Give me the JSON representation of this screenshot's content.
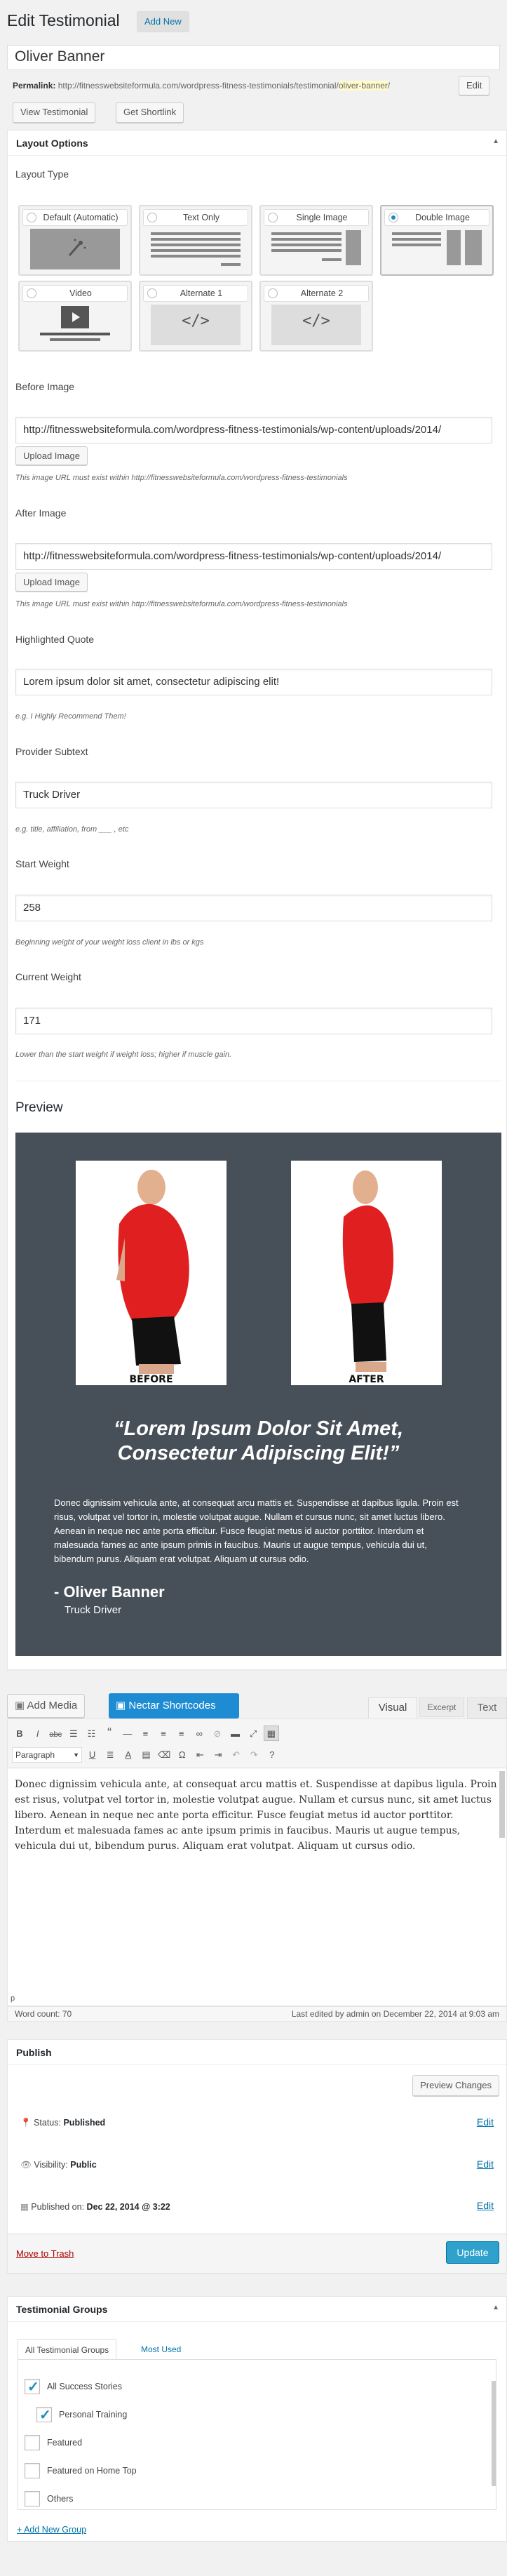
{
  "header": {
    "title": "Edit Testimonial",
    "add_new": "Add New"
  },
  "post": {
    "title": "Oliver Banner",
    "permalink_label": "Permalink:",
    "permalink_base": "http://fitnesswebsiteformula.com/wordpress-fitness-testimonials/testimonial/",
    "permalink_slug": "oliver-banner",
    "permalink_end": "/",
    "edit_button": "Edit",
    "view_button": "View Testimonial",
    "shortlink_button": "Get Shortlink"
  },
  "layout_panel": {
    "title": "Layout Options",
    "layout_type_label": "Layout Type",
    "options": [
      {
        "label": "Default (Automatic)",
        "selected": false,
        "icon": "magic-wand-icon"
      },
      {
        "label": "Text Only",
        "selected": false,
        "icon": "text-lines-icon"
      },
      {
        "label": "Single Image",
        "selected": false,
        "icon": "single-image-icon"
      },
      {
        "label": "Double Image",
        "selected": true,
        "icon": "double-image-icon"
      },
      {
        "label": "Video",
        "selected": false,
        "icon": "video-icon"
      },
      {
        "label": "Alternate 1",
        "selected": false,
        "icon": "code-icon"
      },
      {
        "label": "Alternate 2",
        "selected": false,
        "icon": "code-icon"
      }
    ],
    "before_image": {
      "label": "Before Image",
      "value": "http://fitnesswebsiteformula.com/wordpress-fitness-testimonials/wp-content/uploads/2014/",
      "upload": "Upload Image",
      "hint": "This image URL must exist within http://fitnesswebsiteformula.com/wordpress-fitness-testimonials"
    },
    "after_image": {
      "label": "After Image",
      "value": "http://fitnesswebsiteformula.com/wordpress-fitness-testimonials/wp-content/uploads/2014/",
      "upload": "Upload Image",
      "hint": "This image URL must exist within http://fitnesswebsiteformula.com/wordpress-fitness-testimonials"
    },
    "highlighted_quote": {
      "label": "Highlighted Quote",
      "value": "Lorem ipsum dolor sit amet, consectetur adipiscing elit!",
      "hint": "e.g. I Highly Recommend Them!"
    },
    "provider_subtext": {
      "label": "Provider Subtext",
      "value": "Truck Driver",
      "hint": "e.g. title, affiliation, from ___ , etc"
    },
    "start_weight": {
      "label": "Start Weight",
      "value": "258",
      "hint": "Beginning weight of your weight loss client in lbs or kgs"
    },
    "current_weight": {
      "label": "Current Weight",
      "value": "171",
      "hint": "Lower than the start weight if weight loss; higher if muscle gain."
    }
  },
  "preview": {
    "heading": "Preview",
    "before_label": "BEFORE",
    "after_label": "AFTER",
    "quote_line1": "“Lorem Ipsum Dolor Sit Amet,",
    "quote_line2": "Consectetur Adipiscing Elit!”",
    "body": "Donec dignissim vehicula ante, at consequat arcu mattis et. Suspendisse at dapibus ligula. Proin est risus, volutpat vel tortor in, molestie volutpat augue. Nullam et cursus nunc, sit amet luctus libero. Aenean in neque nec ante porta efficitur. Fusce feugiat metus id auctor porttitor. Interdum et malesuada fames ac ante ipsum primis in faucibus. Mauris ut augue tempus, vehicula dui ut, bibendum purus. Aliquam erat volutpat. Aliquam ut cursus odio.",
    "name": "- Oliver Banner",
    "subtext": "Truck Driver",
    "colors": {
      "background": "#474f58",
      "shirt": "#e02020"
    }
  },
  "editor": {
    "add_media": "Add Media",
    "nectar": "Nectar Shortcodes",
    "tab_visual": "Visual",
    "tab_excerpt": "Excerpt",
    "tab_text": "Text",
    "paragraph_select": "Paragraph",
    "content": "Donec dignissim vehicula ante, at consequat arcu mattis et. Suspendisse at dapibus ligula. Proin est risus, volutpat vel tortor in, molestie volutpat augue. Nullam et cursus nunc, sit amet luctus libero. Aenean in neque nec ante porta efficitur. Fusce feugiat metus id auctor porttitor. Interdum et malesuada fames ac ante ipsum primis in faucibus. Mauris ut augue tempus, vehicula dui ut, bibendum purus. Aliquam erat volutpat. Aliquam ut cursus odio.",
    "path": "p",
    "word_count": "Word count: 70",
    "last_edited": "Last edited by admin on December 22, 2014 at 9:03 am"
  },
  "publish": {
    "title": "Publish",
    "preview_changes": "Preview Changes",
    "status_label": "Status:",
    "status_value": "Published",
    "visibility_label": "Visibility:",
    "visibility_value": "Public",
    "published_label": "Published on:",
    "published_value": "Dec 22, 2014 @ 3:22",
    "edit": "Edit",
    "trash": "Move to Trash",
    "update": "Update"
  },
  "groups": {
    "title": "Testimonial Groups",
    "tab_all": "All Testimonial Groups",
    "tab_most_used": "Most Used",
    "items": [
      {
        "label": "All Success Stories",
        "checked": true,
        "indent": false
      },
      {
        "label": "Personal Training",
        "checked": true,
        "indent": true
      },
      {
        "label": "Featured",
        "checked": false,
        "indent": false
      },
      {
        "label": "Featured on Home Top",
        "checked": false,
        "indent": false
      },
      {
        "label": "Others",
        "checked": false,
        "indent": false
      }
    ],
    "add_new": "+ Add New Group"
  }
}
